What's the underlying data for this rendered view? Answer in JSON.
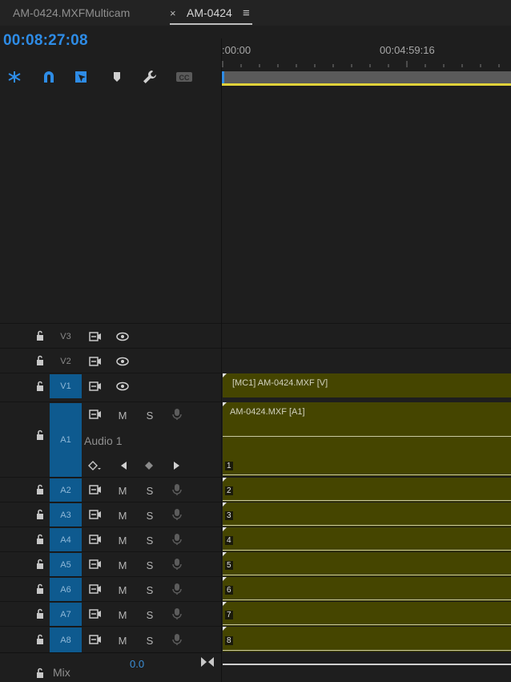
{
  "tabs": [
    {
      "label": "AM-0424.MXFMulticam",
      "active": false
    },
    {
      "label": "AM-0424",
      "active": true
    }
  ],
  "tab_close_glyph": "×",
  "tab_menu_glyph": "≡",
  "timecode": "00:08:27:08",
  "toolbar": [
    {
      "icon": "snap-nest-icon",
      "active": true
    },
    {
      "icon": "magnet-snap-icon",
      "active": true
    },
    {
      "icon": "linked-selection-icon",
      "active": true
    },
    {
      "icon": "add-marker-icon",
      "active": false
    },
    {
      "icon": "wrench-settings-icon",
      "active": false
    },
    {
      "icon": "closed-captions-icon",
      "active": false
    }
  ],
  "ruler": {
    "start_label": ":00:00",
    "mid_label": "00:04:59:16"
  },
  "video_tracks": [
    {
      "name": "V3",
      "targeted": false
    },
    {
      "name": "V2",
      "targeted": false
    },
    {
      "name": "V1",
      "targeted": true
    }
  ],
  "audio_tracks": [
    {
      "name": "A1",
      "label": "Audio 1",
      "channel": "1"
    },
    {
      "name": "A2",
      "channel": "2"
    },
    {
      "name": "A3",
      "channel": "3"
    },
    {
      "name": "A4",
      "channel": "4"
    },
    {
      "name": "A5",
      "channel": "5"
    },
    {
      "name": "A6",
      "channel": "6"
    },
    {
      "name": "A7",
      "channel": "7"
    },
    {
      "name": "A8",
      "channel": "8"
    }
  ],
  "track_buttons": {
    "mute": "M",
    "solo": "S"
  },
  "clips": {
    "video": "[MC1] AM-0424.MXF [V]",
    "audio": "AM-0424.MXF [A1]"
  },
  "mix": {
    "label": "Mix",
    "value": "0.0"
  },
  "colors": {
    "accent": "#2e8ce6",
    "target": "#0e5a8f",
    "clip": "#454500",
    "work_area": "#e0d23a"
  }
}
